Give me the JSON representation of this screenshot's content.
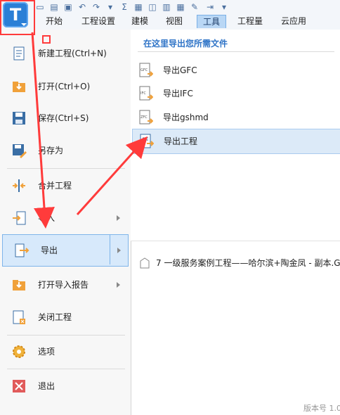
{
  "ribbon": {
    "tabs": [
      {
        "label": "开始"
      },
      {
        "label": "工程设置"
      },
      {
        "label": "建模"
      },
      {
        "label": "视图"
      },
      {
        "label": "工具"
      },
      {
        "label": "工程量"
      },
      {
        "label": "云应用"
      }
    ],
    "active_tab": "工具",
    "quick_icons": [
      "new-file-icon",
      "open-folder-icon",
      "save-icon",
      "undo-icon",
      "redo-icon",
      "sum-icon",
      "table-icon",
      "find-icon",
      "calculator-icon",
      "pencil-icon",
      "export-icon",
      "dropdown-icon"
    ]
  },
  "logo": {
    "letter": "T"
  },
  "menu": {
    "items": [
      {
        "label": "新建工程(Ctrl+N)"
      },
      {
        "label": "打开(Ctrl+O)"
      },
      {
        "label": "保存(Ctrl+S)"
      },
      {
        "label": "另存为"
      },
      {
        "label": "合并工程"
      },
      {
        "label": "导入"
      },
      {
        "label": "导出"
      },
      {
        "label": "打开导入报告"
      },
      {
        "label": "关闭工程"
      },
      {
        "label": "选项"
      },
      {
        "label": "退出"
      }
    ]
  },
  "export_panel": {
    "title": "在这里导出您所需文件",
    "items": [
      {
        "label": "导出GFC",
        "icon_text": "GFC"
      },
      {
        "label": "导出IFC",
        "icon_text": "IFC"
      },
      {
        "label": "导出gshmd",
        "icon_text": "ZFC"
      },
      {
        "label": "导出工程",
        "icon_text": ""
      }
    ]
  },
  "recent": {
    "label": "7 一级服务案例工程——哈尔滨+陶金凤 - 副本.G"
  },
  "footer": {
    "version": "版本号 1.0"
  },
  "colors": {
    "accent": "#2b7fd6",
    "highlight": "#d7e9fb",
    "annotation": "#ff3b3b"
  }
}
